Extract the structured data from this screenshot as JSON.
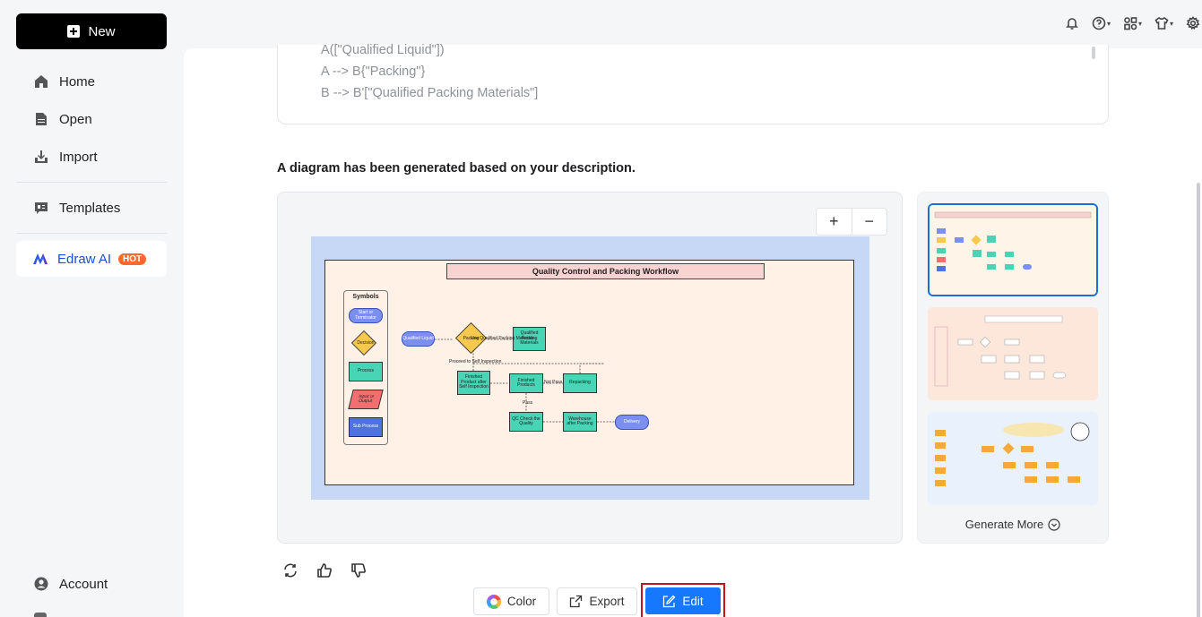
{
  "sidebar": {
    "new_label": "New",
    "items": [
      {
        "label": "Home",
        "icon": "home-icon"
      },
      {
        "label": "Open",
        "icon": "file-icon"
      },
      {
        "label": "Import",
        "icon": "import-icon"
      },
      {
        "label": "Templates",
        "icon": "templates-icon"
      }
    ],
    "ai": {
      "label": "Edraw AI",
      "badge": "HOT"
    },
    "account_label": "Account"
  },
  "code": {
    "lines": [
      "A([\"Qualified Liquid\"])",
      "A --> B{\"Packing\"}",
      "B --> B'[\"Qualified Packing Materials\"]"
    ]
  },
  "main": {
    "generated_text": "A diagram has been generated based on your description.",
    "zoom_in": "+",
    "zoom_out": "−",
    "generate_more": "Generate More",
    "color_label": "Color",
    "export_label": "Export",
    "edit_label": "Edit"
  },
  "diagram": {
    "title": "Quality Control and Packing Workflow",
    "legend_title": "Symbols",
    "legend": {
      "start": "Start or Terminator",
      "decision": "Decision",
      "process": "Process",
      "io": "Input or Output",
      "sub": "Sub Process"
    },
    "nodes": {
      "qualified_liquid": "Qualified Liquid",
      "packing": "Packing",
      "qualified_packing": "Qualified Packing Materials",
      "use_qualified": "Use Qualified Packing Materials",
      "finished_after": "Finished Product after Self Inspection",
      "finished": "Finished Products",
      "repacking": "Repacking",
      "qc_check": "QC Check the Quality",
      "warehouse": "Warehouse after Packing",
      "delivery": "Delivery",
      "proceed": "Proceed to Self Inspection",
      "not_pass": "Not Pass",
      "pass": "Pass"
    }
  },
  "colors": {
    "accent": "#1677ff",
    "highlight_border": "#c0151d",
    "hot": "#ff6a2b",
    "ai_text": "#1a4fd6"
  }
}
